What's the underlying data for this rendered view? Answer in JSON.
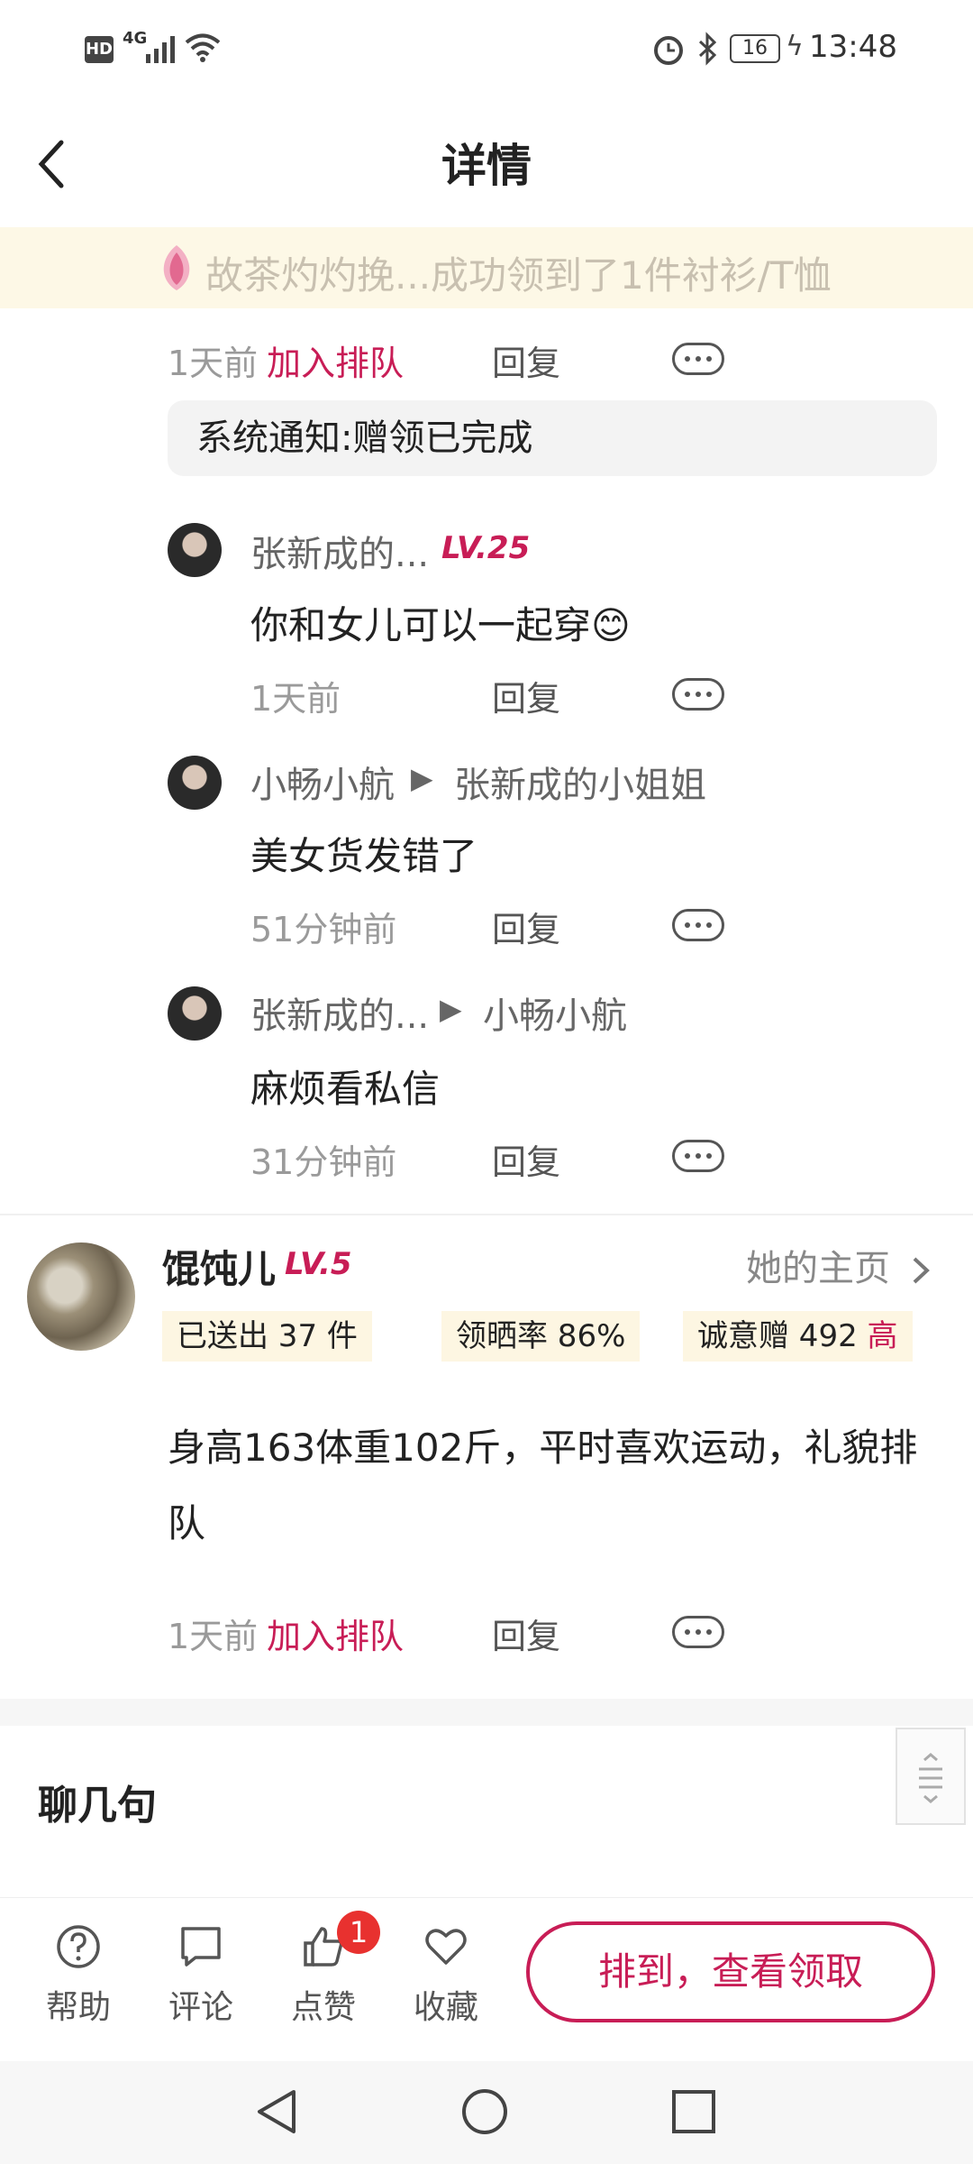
{
  "status_bar": {
    "hd": "HD",
    "network": "4G",
    "battery": "16",
    "time": "13:48"
  },
  "header": {
    "title": "详情"
  },
  "banner": {
    "text": "故茶灼灼挽...成功领到了1件衬衫/T恤"
  },
  "first_comment": {
    "time": "1天前",
    "queue_label": "加入排队",
    "reply": "回复"
  },
  "system_notice": "系统通知:赠领已完成",
  "replies": [
    {
      "name": "张新成的...",
      "level": "LV.25",
      "target": "",
      "content": "你和女儿可以一起穿😊",
      "time": "1天前",
      "reply": "回复"
    },
    {
      "name": "小畅小航",
      "level": "",
      "target": "张新成的小姐姐",
      "content": "美女货发错了",
      "time": "51分钟前",
      "reply": "回复"
    },
    {
      "name": "张新成的...",
      "level": "",
      "target": "小畅小航",
      "content": "麻烦看私信",
      "time": "31分钟前",
      "reply": "回复"
    }
  ],
  "user": {
    "name": "馄饨儿",
    "level": "LV.5",
    "homepage": "她的主页",
    "stats": {
      "sent": "已送出 37 件",
      "rate": "领晒率 86%",
      "sincerity": "诚意赠 492",
      "sincerity_level": "高"
    },
    "content": "身高163体重102斤，平时喜欢运动，礼貌排队",
    "time": "1天前",
    "queue_label": "加入排队",
    "reply": "回复"
  },
  "chat": {
    "title": "聊几句"
  },
  "bottom_bar": {
    "help": "帮助",
    "comment": "评论",
    "like": "点赞",
    "like_badge": "1",
    "favorite": "收藏",
    "cta": "排到，查看领取"
  },
  "colors": {
    "accent": "#c81d56",
    "banner_bg": "#fdf8e6"
  }
}
